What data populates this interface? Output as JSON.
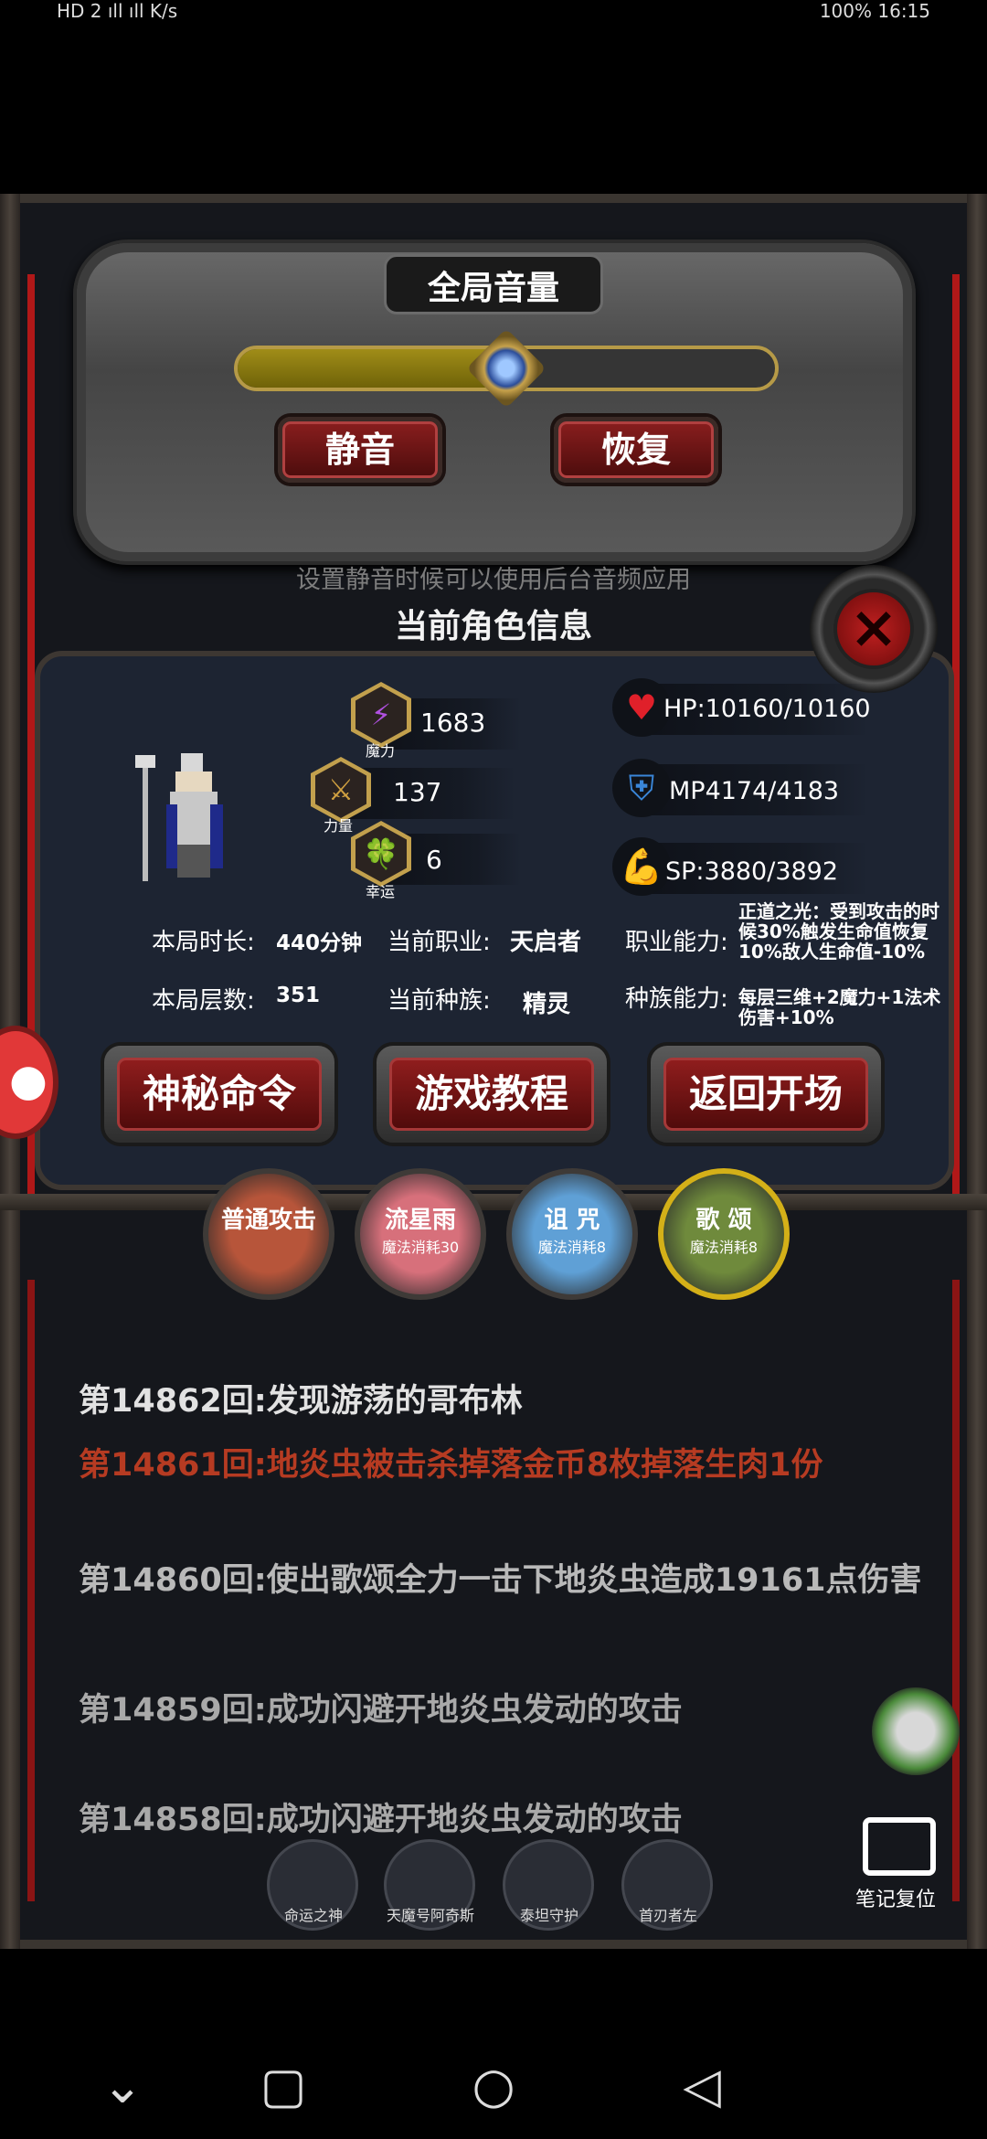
{
  "status_bar": {
    "left_text": "HD 2 ıll ıll K/s",
    "right_text": "100% 16:15"
  },
  "volume": {
    "title": "全局音量",
    "level_percent": 50,
    "mute_label": "静音",
    "restore_label": "恢复",
    "hint": "设置静音时候可以使用后台音频应用"
  },
  "character": {
    "title": "当前角色信息",
    "stats": [
      {
        "icon": "magic-icon",
        "glyph": "⚡",
        "value": "1683",
        "label": "魔力"
      },
      {
        "icon": "strength-icon",
        "glyph": "⚔",
        "value": "137",
        "label": "力量"
      },
      {
        "icon": "luck-icon",
        "glyph": "🍀",
        "value": "6",
        "label": "幸运"
      }
    ],
    "resources": [
      {
        "icon": "heart-icon",
        "glyph": "♥",
        "color": "#e0202a",
        "text": "HP:10160/10160"
      },
      {
        "icon": "mana-icon",
        "glyph": "⛨",
        "color": "#3a86d8",
        "text": "MP4174/4183"
      },
      {
        "icon": "stamina-icon",
        "glyph": "💪",
        "color": "#e2b21a",
        "text": "SP:3880/3892"
      }
    ],
    "info": {
      "duration_label": "本局时长:",
      "duration_value": "440分钟",
      "class_label": "当前职业:",
      "class_value": "天启者",
      "class_ability_label": "职业能力:",
      "class_ability_value": "正道之光：受到攻击的时候30%触发生命值恢复10%敌人生命值-10%",
      "floors_label": "本局层数:",
      "floors_value": "351",
      "race_label": "当前种族:",
      "race_value": "精灵",
      "race_ability_label": "种族能力:",
      "race_ability_value": "每层三维+2魔力+1法术伤害+10%"
    },
    "buttons": [
      "神秘命令",
      "游戏教程",
      "返回开场"
    ]
  },
  "skills": [
    {
      "name": "普通攻击",
      "cost": "",
      "color": "#b7553a"
    },
    {
      "name": "流星雨",
      "cost": "魔法消耗30",
      "color": "#d7707b"
    },
    {
      "name": "诅 咒",
      "cost": "魔法消耗8",
      "color": "#5fa0d6"
    },
    {
      "name": "歌 颂",
      "cost": "魔法消耗8",
      "color": "#6f8a3c"
    }
  ],
  "log": [
    {
      "text": "第14862回:发现游荡的哥布林",
      "color": "#e2e2e2"
    },
    {
      "text": "第14861回:地炎虫被击杀掉落金币8枚掉落生肉1份",
      "color": "#b63b22"
    },
    {
      "text": "第14860回:使出歌颂全力一击下地炎虫造成19161点伤害",
      "color": "#b9b9b9"
    },
    {
      "text": "第14859回:成功闪避开地炎虫发动的攻击",
      "color": "#a9a9a9"
    },
    {
      "text": "第14858回:成功闪避开地炎虫发动的攻击",
      "color": "#a9a9a9"
    }
  ],
  "bottom_items": [
    "命运之神",
    "天魔号阿奇斯",
    "泰坦守护",
    "首刃者左"
  ],
  "notes_reset_label": "笔记复位"
}
